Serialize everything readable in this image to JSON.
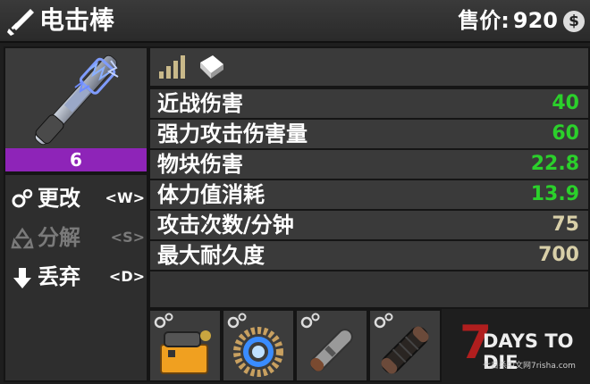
{
  "header": {
    "title": "电击棒",
    "price_label": "售价:",
    "price_value": "920",
    "coin_symbol": "$"
  },
  "item": {
    "quality": "6",
    "quality_color": "#8e24b8",
    "icon": "stun-baton-icon"
  },
  "actions": [
    {
      "label": "更改",
      "key": "<W>",
      "icon": "gears-icon",
      "enabled": true
    },
    {
      "label": "分解",
      "key": "<S>",
      "icon": "recycle-icon",
      "enabled": false
    },
    {
      "label": "丢弃",
      "key": "<D>",
      "icon": "arrow-down-icon",
      "enabled": true
    }
  ],
  "stats": [
    {
      "name": "近战伤害",
      "value": "40",
      "color": "green"
    },
    {
      "name": "强力攻击伤害量",
      "value": "60",
      "color": "green"
    },
    {
      "name": "物块伤害",
      "value": "22.8",
      "color": "green"
    },
    {
      "name": "体力值消耗",
      "value": "13.9",
      "color": "green"
    },
    {
      "name": "攻击次数/分钟",
      "value": "75",
      "color": "tan"
    },
    {
      "name": "最大耐久度",
      "value": "700",
      "color": "tan"
    }
  ],
  "mods": [
    "battery-mod-icon",
    "coil-mod-icon",
    "tube-mod-icon",
    "handle-mod-icon"
  ],
  "logo": {
    "seven": "7",
    "text": "DAYS TO DIE",
    "sub": "七日杀中文网7risha.com"
  }
}
